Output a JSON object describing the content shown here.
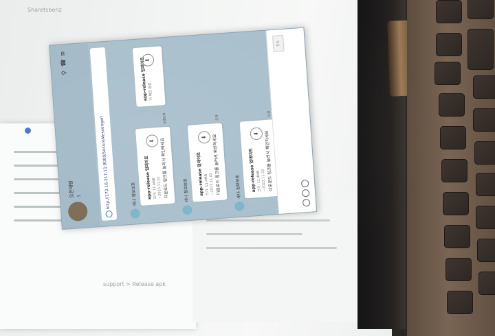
{
  "chat": {
    "room_name": "오픈채팅",
    "member_count": "3",
    "url": "http://172.16.217.11:8000/SecureMessenger/",
    "messages": [
      {
        "sender": "세나 정보보호",
        "title": "app-release 업데이트",
        "line1": "크기: 11.4MB",
        "line2": "~2023.11.02",
        "link": "다운로드 링크를 눌러서 확인하세요",
        "time": "오후"
      },
      {
        "sender": "세나 정보보호",
        "title": "app-release 업데이트",
        "line1": "크기: 11.4MB",
        "line2": "~2023.11.02",
        "link": "다운로드 링크를 눌러서 확인하세요",
        "time": "오후"
      },
      {
        "sender": "세나 정보보호",
        "title": "app-release 업데이트",
        "line1": "크기: 11.4MB",
        "line2": "~2023.11.02",
        "link": "다운로드 링크를 눌러서 확인하세요",
        "time": "오후"
      }
    ],
    "my_message": {
      "title": "app-release 업데이트",
      "line": "나 확인 완료",
      "time": "오후"
    },
    "send_label": "전송"
  },
  "background": {
    "breadcrumb": "support  >  Release apk",
    "side_label": "Sharetsbenz"
  },
  "colors": {
    "chat_bg": "#a9bfcc",
    "header": "#a3b9c7",
    "link_blue": "#2a3e7a"
  },
  "icons": [
    "search-icon",
    "phone-icon",
    "menu-icon",
    "globe-icon",
    "file-icon",
    "emoji-icon",
    "attach-icon",
    "capture-icon",
    "send-icon"
  ]
}
